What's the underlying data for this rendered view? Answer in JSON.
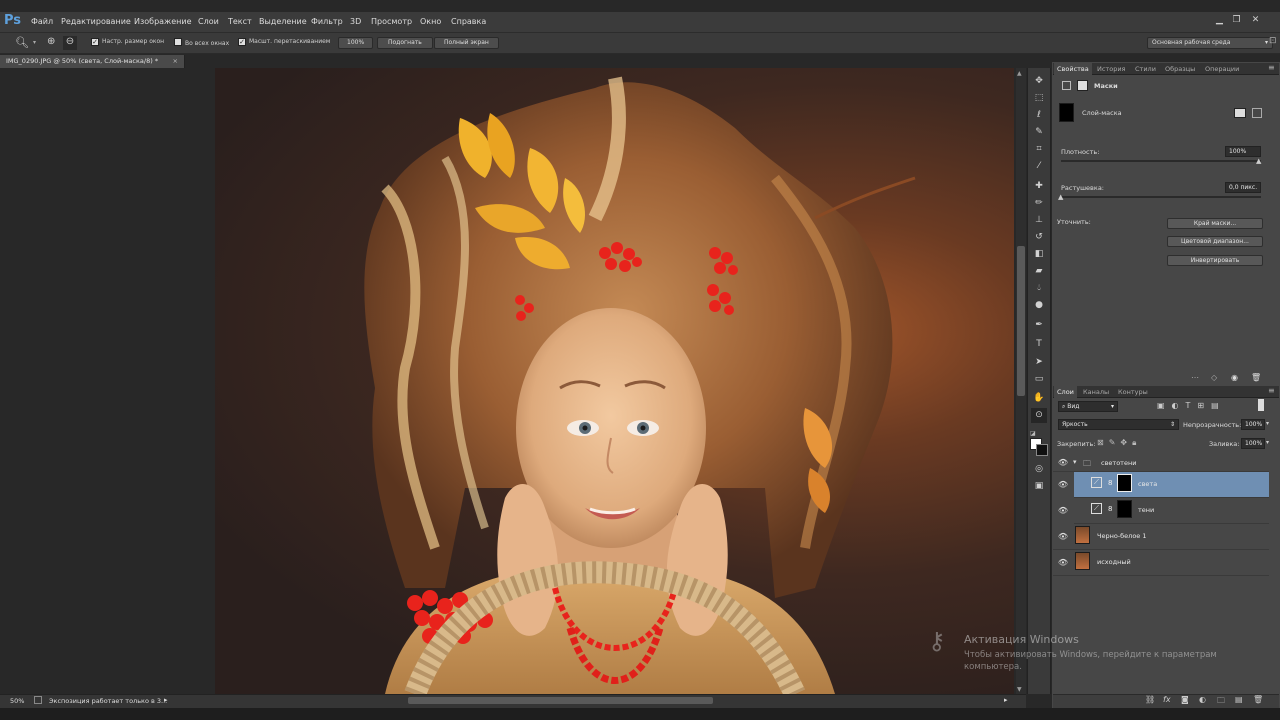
{
  "app": {
    "logo": "Ps"
  },
  "menu": [
    "Файл",
    "Редактирование",
    "Изображение",
    "Слои",
    "Текст",
    "Выделение",
    "Фильтр",
    "3D",
    "Просмотр",
    "Окно",
    "Справка"
  ],
  "options": {
    "resize_windows": "Настр. размер окон",
    "all_windows": "Во всех окнах",
    "scrubby_zoom": "Масшт. перетаскиванием",
    "zoom_btn": "100%",
    "fit_btn": "Подогнать",
    "fullscreen_btn": "Полный экран",
    "workspace": "Основная рабочая среда"
  },
  "document": {
    "tab_title": "IMG_0290.JPG @ 50% (света, Слой-маска/8) *"
  },
  "status": {
    "zoom": "50%",
    "message": "Экспозиция работает только в 3..."
  },
  "properties": {
    "tabs": [
      "Свойства",
      "История",
      "Стили",
      "Образцы",
      "Операции"
    ],
    "header": "Маски",
    "mask_label": "Слой-маска",
    "density_label": "Плотность:",
    "density_value": "100%",
    "feather_label": "Растушевка:",
    "feather_value": "0,0 пикс.",
    "refine_label": "Уточнить:",
    "btn_mask_edge": "Край маски...",
    "btn_color_range": "Цветовой диапазон...",
    "btn_invert": "Инвертировать"
  },
  "layers": {
    "tabs": [
      "Слои",
      "Каналы",
      "Контуры"
    ],
    "filter_kind": "Вид",
    "blend_mode": "Яркость",
    "opacity_label": "Непрозрачность:",
    "opacity_value": "100%",
    "lock_label": "Закрепить:",
    "fill_label": "Заливка:",
    "fill_value": "100%",
    "items": [
      {
        "name": "светотени"
      },
      {
        "name": "света"
      },
      {
        "name": "тени"
      },
      {
        "name": "Черно-белое 1"
      },
      {
        "name": "исходный"
      }
    ]
  },
  "watermark": {
    "title": "Активация Windows",
    "text": "Чтобы активировать Windows, перейдите к параметрам компьютера."
  }
}
